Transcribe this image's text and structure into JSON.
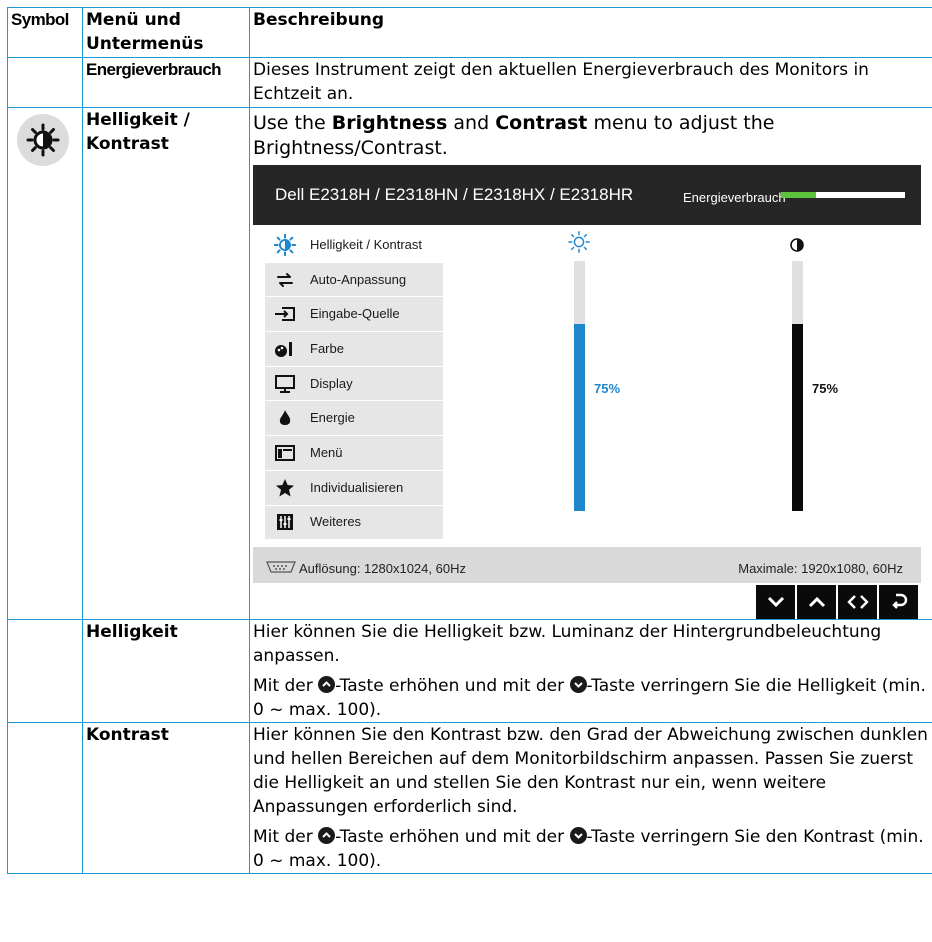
{
  "table": {
    "headers": [
      "Symbol",
      "Menü und Untermenüs",
      "Beschreibung"
    ],
    "row_energy": {
      "label": "Energieverbrauch",
      "text": "Dieses Instrument zeigt den aktuellen Energieverbrauch des Monitors in Echtzeit an."
    },
    "row_bc": {
      "label": "Helligkeit / Kontrast",
      "lead_1": "Use the ",
      "lead_brightness": "Brightness",
      "lead_2": " and ",
      "lead_contrast": "Contrast",
      "lead_3": " menu to adjust the Brightness/Contrast."
    },
    "row_brightness": {
      "label": "Helligkeit",
      "text_1": "Hier können Sie die Helligkeit bzw. Luminanz der Hintergrundbeleuchtung anpassen.",
      "text_2a": "Mit der ",
      "text_2b": "-Taste erhöhen und mit der ",
      "text_2c": "-Taste verringern Sie die Helligkeit (min. 0 ~ max. 100)."
    },
    "row_contrast": {
      "label": "Kontrast",
      "text_1": "Hier können Sie den Kontrast bzw. den Grad der Abweichung zwischen dunklen und hellen Bereichen auf dem Monitorbildschirm anpassen. Passen Sie zuerst die Helligkeit an und stellen Sie den Kontrast nur ein, wenn weitere Anpassungen erforderlich sind.",
      "text_2a": "Mit der ",
      "text_2b": "-Taste erhöhen und mit der ",
      "text_2c": "-Taste verringern Sie den Kontrast (min. 0 ~ max. 100)."
    }
  },
  "osd": {
    "model": "Dell E2318H / E2318HN / E2318HX / E2318HR",
    "energy_label": "Energieverbrauch",
    "energy_level": 0.28,
    "menu": [
      {
        "label": "Helligkeit / Kontrast",
        "icon": "brightness-icon"
      },
      {
        "label": "Auto-Anpassung",
        "icon": "auto-adjust-icon"
      },
      {
        "label": "Eingabe-Quelle",
        "icon": "input-source-icon"
      },
      {
        "label": "Farbe",
        "icon": "color-icon"
      },
      {
        "label": "Display",
        "icon": "display-icon"
      },
      {
        "label": "Energie",
        "icon": "energy-icon"
      },
      {
        "label": "Menü",
        "icon": "menu-icon"
      },
      {
        "label": "Individualisieren",
        "icon": "star-icon"
      },
      {
        "label": "Weiteres",
        "icon": "others-icon"
      }
    ],
    "brightness_value": "75%",
    "contrast_value": "75%",
    "brightness_level": 0.75,
    "contrast_level": 0.75,
    "resolution": "Auflösung: 1280x1024, 60Hz",
    "max_resolution": "Maximale: 1920x1080, 60Hz",
    "nav_buttons": [
      "chevron-down-icon",
      "chevron-up-icon",
      "left-right-icon",
      "back-icon"
    ],
    "colors": {
      "brightness_bar": "#1f87cc",
      "contrast_bar": "#0a0a0a",
      "energy_bar": "#5cc43a",
      "header_bg": "#262626"
    }
  }
}
